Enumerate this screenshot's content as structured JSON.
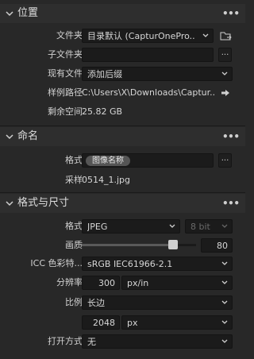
{
  "location": {
    "title": "位置",
    "folder_label": "文件夹",
    "folder_value": "目录默认 (CapturOnePro...",
    "subfolder_label": "子文件夹",
    "subfolder_value": "",
    "subfolder_btn": "...",
    "existing_label": "现有文件",
    "existing_value": "添加后缀",
    "path_label": "样例路径",
    "path_value": "C:\\Users\\X\\Downloads\\Captur...",
    "free_label": "剩余空间",
    "free_value": "25.82 GB"
  },
  "naming": {
    "title": "命名",
    "format_label": "格式",
    "format_token": "图像名称",
    "format_btn": "...",
    "sample_label": "采样",
    "sample_value": "0514_1.jpg"
  },
  "format_size": {
    "title": "格式与尺寸",
    "format_label": "格式",
    "format_value": "JPEG",
    "bit_value": "8 bit",
    "quality_label": "画质",
    "quality_value": "80",
    "quality_fraction": 0.8,
    "icc_label": "ICC 色彩特...",
    "icc_value": "sRGB IEC61966-2.1",
    "resolution_label": "分辨率",
    "resolution_value": "300",
    "resolution_unit": "px/in",
    "scale_label": "比例",
    "scale_value": "长边",
    "size_value": "2048",
    "size_unit": "px",
    "open_label": "打开方式",
    "open_value": "无"
  },
  "more_menu": "•••",
  "colors": {
    "background": "#282828",
    "header": "#2e2e2e",
    "field": "#1b1b1b",
    "token": "#555555"
  }
}
